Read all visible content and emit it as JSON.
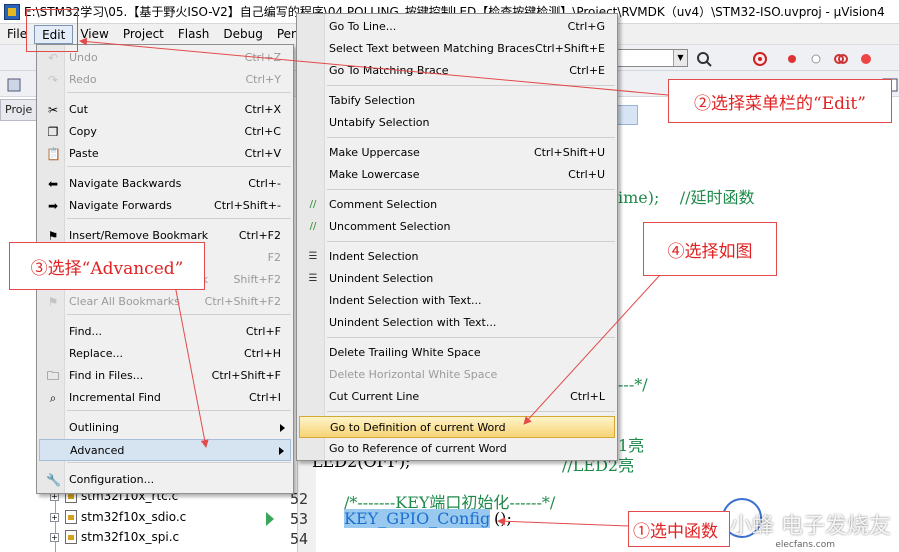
{
  "window": {
    "title": "E:\\STM32学习\\05.【基于野火ISO-V2】自己编写的程序\\04.POLLING_按键控制LED【检查按键检测】\\Project\\RVMDK（uv4）\\STM32-ISO.uvproj - µVision4"
  },
  "menubar": {
    "items": [
      "File",
      "Edit",
      "View",
      "Project",
      "Flash",
      "Debug",
      "Periph"
    ]
  },
  "project_panel": {
    "tab_label": "Proje",
    "files": [
      "stm32f10x_rtc.c",
      "stm32f10x_sdio.c",
      "stm32f10x_spi.c"
    ]
  },
  "editor": {
    "tab_label": "h",
    "line_numbers": [
      "52",
      "53",
      "54"
    ],
    "code_lines": [
      {
        "text": "ime);    //延时函数"
      },
      {
        "text": "---*/"
      },
      {
        "text": "1亮"
      },
      {
        "text": "LED2(OFF);"
      },
      {
        "text": "//LED2亮"
      },
      {
        "text": "/*-------KEY端口初始化------*/"
      },
      {
        "text": "KEY_GPIO_Config"
      },
      {
        "text": "();"
      }
    ]
  },
  "edit_menu": {
    "items": [
      {
        "label": "Undo",
        "shortcut": "Ctrl+Z",
        "icon": "undo-icon",
        "disabled": true
      },
      {
        "label": "Redo",
        "shortcut": "Ctrl+Y",
        "icon": "redo-icon",
        "disabled": true
      },
      {
        "label": "Cut",
        "shortcut": "Ctrl+X",
        "icon": "cut-icon",
        "disabled": false
      },
      {
        "label": "Copy",
        "shortcut": "Ctrl+C",
        "icon": "copy-icon",
        "disabled": false
      },
      {
        "label": "Paste",
        "shortcut": "Ctrl+V",
        "icon": "paste-icon",
        "disabled": false
      },
      {
        "label": "Navigate Backwards",
        "shortcut": "Ctrl+-",
        "icon": "arrow-left-icon",
        "disabled": false
      },
      {
        "label": "Navigate Forwards",
        "shortcut": "Ctrl+Shift+-",
        "icon": "arrow-right-icon",
        "disabled": false
      },
      {
        "label": "Insert/Remove Bookmark",
        "shortcut": "Ctrl+F2",
        "icon": "bookmark-icon",
        "disabled": false
      },
      {
        "label": "Go to Next Bookmark",
        "shortcut": "F2",
        "icon": "next-bookmark-icon",
        "disabled": true
      },
      {
        "label": "Go to Previous Bookmark",
        "shortcut": "Shift+F2",
        "icon": "prev-bookmark-icon",
        "disabled": true
      },
      {
        "label": "Clear All Bookmarks",
        "shortcut": "Ctrl+Shift+F2",
        "icon": "clear-bookmarks-icon",
        "disabled": true
      },
      {
        "label": "Find...",
        "shortcut": "Ctrl+F",
        "icon": "",
        "disabled": false
      },
      {
        "label": "Replace...",
        "shortcut": "Ctrl+H",
        "icon": "",
        "disabled": false
      },
      {
        "label": "Find in Files...",
        "shortcut": "Ctrl+Shift+F",
        "icon": "find-in-files-icon",
        "disabled": false
      },
      {
        "label": "Incremental Find",
        "shortcut": "Ctrl+I",
        "icon": "incremental-find-icon",
        "disabled": false
      },
      {
        "label": "Outlining",
        "shortcut": "",
        "icon": "",
        "disabled": false
      },
      {
        "label": "Advanced",
        "shortcut": "",
        "icon": "",
        "disabled": false
      },
      {
        "label": "Configuration...",
        "shortcut": "",
        "icon": "wrench-icon",
        "disabled": false
      }
    ]
  },
  "advanced_menu": {
    "items": [
      {
        "label": "Go To Line...",
        "shortcut": "Ctrl+G",
        "disabled": false
      },
      {
        "label": "Select Text between Matching Braces",
        "shortcut": "Ctrl+Shift+E",
        "disabled": false
      },
      {
        "label": "Go To Matching Brace",
        "shortcut": "Ctrl+E",
        "disabled": false
      },
      {
        "label": "Tabify Selection",
        "shortcut": "",
        "disabled": false
      },
      {
        "label": "Untabify Selection",
        "shortcut": "",
        "disabled": false
      },
      {
        "label": "Make Uppercase",
        "shortcut": "Ctrl+Shift+U",
        "disabled": false
      },
      {
        "label": "Make Lowercase",
        "shortcut": "Ctrl+U",
        "disabled": false
      },
      {
        "label": "Comment Selection",
        "shortcut": "",
        "disabled": false
      },
      {
        "label": "Uncomment Selection",
        "shortcut": "",
        "disabled": false
      },
      {
        "label": "Indent Selection",
        "shortcut": "",
        "disabled": false
      },
      {
        "label": "Unindent Selection",
        "shortcut": "",
        "disabled": false
      },
      {
        "label": "Indent Selection with Text...",
        "shortcut": "",
        "disabled": false
      },
      {
        "label": "Unindent Selection with Text...",
        "shortcut": "",
        "disabled": false
      },
      {
        "label": "Delete Trailing White Space",
        "shortcut": "",
        "disabled": false
      },
      {
        "label": "Delete Horizontal White Space",
        "shortcut": "",
        "disabled": true
      },
      {
        "label": "Cut Current Line",
        "shortcut": "Ctrl+L",
        "disabled": false
      },
      {
        "label": "Go to Definition of current Word",
        "shortcut": "",
        "disabled": false
      },
      {
        "label": "Go to Reference of current Word",
        "shortcut": "",
        "disabled": false
      }
    ]
  },
  "annotations": {
    "step1": "①选中函数",
    "step2": "②选择菜单栏的“Edit”",
    "step3": "③选择“Advanced”",
    "step4": "④选择如图"
  },
  "watermark": {
    "main": "小蜂 电子发烧友",
    "sub": "elecfans.com"
  },
  "colors": {
    "annotation_red": "#e02222",
    "comment_green": "#1f8a4a",
    "selection_blue": "#99c9ef",
    "highlight_gold": "#f6d376"
  }
}
